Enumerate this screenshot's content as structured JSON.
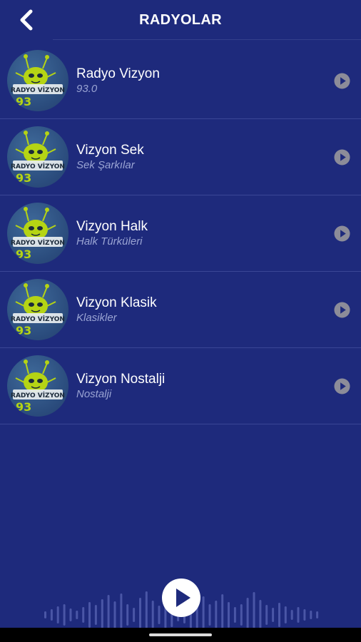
{
  "header": {
    "title": "RADYOLAR",
    "back_icon": "chevron-left-icon"
  },
  "stations": [
    {
      "name": "Radyo Vizyon",
      "subtitle": "93.0",
      "logo_text": "RADYO VİZYON",
      "logo_number": "93"
    },
    {
      "name": "Vizyon Sek",
      "subtitle": "Sek Şarkılar",
      "logo_text": "RADYO VİZYON",
      "logo_number": "93"
    },
    {
      "name": "Vizyon Halk",
      "subtitle": "Halk Türküleri",
      "logo_text": "RADYO VİZYON",
      "logo_number": "93"
    },
    {
      "name": "Vizyon Klasik",
      "subtitle": "Klasikler",
      "logo_text": "RADYO VİZYON",
      "logo_number": "93"
    },
    {
      "name": "Vizyon Nostalji",
      "subtitle": "Nostalji",
      "logo_text": "RADYO VİZYON",
      "logo_number": "93"
    }
  ],
  "player": {
    "play_icon": "play-icon"
  },
  "colors": {
    "background": "#1e2a7c",
    "subtitle": "#9aa4d3",
    "accent_logo": "#b5d414"
  }
}
